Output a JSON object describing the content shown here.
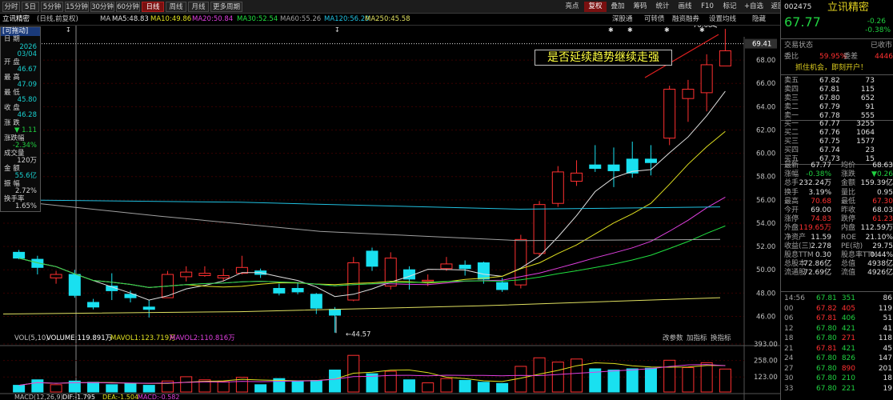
{
  "toolbar": {
    "left": [
      {
        "label": "分时",
        "active": false
      },
      {
        "label": "5日",
        "active": false
      },
      {
        "label": "5分钟",
        "active": false
      },
      {
        "label": "15分钟",
        "active": false
      },
      {
        "label": "30分钟",
        "active": false
      },
      {
        "label": "60分钟",
        "active": false
      },
      {
        "label": "日线",
        "active": true
      },
      {
        "label": "周线",
        "active": false
      },
      {
        "label": "月线",
        "active": false
      },
      {
        "label": "更多周期",
        "active": false
      }
    ],
    "right": [
      {
        "label": "亮点",
        "red": false
      },
      {
        "label": "复权",
        "red": true
      },
      {
        "label": "叠加",
        "red": false
      },
      {
        "label": "筹码",
        "red": false
      },
      {
        "label": "统计",
        "red": false
      },
      {
        "label": "画线",
        "red": false
      },
      {
        "label": "F10",
        "red": false
      },
      {
        "label": "标记",
        "red": false
      },
      {
        "label": "+自选",
        "red": false
      },
      {
        "label": "返回",
        "red": false
      }
    ]
  },
  "subbar": {
    "name": "立讯精密",
    "mode": "(日线,前复权)",
    "ma_label": "MA",
    "ma": [
      {
        "t": "MA5:48.83",
        "c": "#e0e0e0"
      },
      {
        "t": "MA10:49.86",
        "c": "#e0e020"
      },
      {
        "t": "MA20:50.84",
        "c": "#e040e0"
      },
      {
        "t": "MA30:52.54",
        "c": "#20e040"
      },
      {
        "t": "MA60:55.26",
        "c": "#a0a0a0"
      },
      {
        "t": "MA120:56.20",
        "c": "#20c0e0"
      },
      {
        "t": "MA250:45.58",
        "c": "#e0e060"
      }
    ],
    "links": [
      "深股通",
      "可转债",
      "融资融券",
      "设置均线"
    ],
    "close_label": "隐藏"
  },
  "panel": {
    "tag": "[可拖动]",
    "rows": [
      {
        "l": "日  期",
        "v": ""
      },
      {
        "l": "",
        "v": "2026"
      },
      {
        "l": "",
        "v": "03/04"
      },
      {
        "l": "开  盘",
        "v": ""
      },
      {
        "l": "",
        "v": "46.67",
        "c": "cyan"
      },
      {
        "l": "最  高",
        "v": ""
      },
      {
        "l": "",
        "v": "47.09",
        "c": "cyan"
      },
      {
        "l": "最  低",
        "v": ""
      },
      {
        "l": "",
        "v": "45.80",
        "c": "cyan"
      },
      {
        "l": "收  盘",
        "v": ""
      },
      {
        "l": "",
        "v": "46.28",
        "c": "cyan"
      },
      {
        "l": "涨  跌",
        "v": ""
      },
      {
        "l": "",
        "v": "▼ 1.11",
        "c": "green"
      },
      {
        "l": "涨跌幅",
        "v": ""
      },
      {
        "l": "",
        "v": "-2.34%",
        "c": "green"
      },
      {
        "l": "成交量",
        "v": ""
      },
      {
        "l": "",
        "v": "120万",
        "c": "white"
      },
      {
        "l": "金  额",
        "v": ""
      },
      {
        "l": "",
        "v": "55.6亿",
        "c": "cyan"
      },
      {
        "l": "振  幅",
        "v": ""
      },
      {
        "l": "",
        "v": "2.72%",
        "c": "white"
      },
      {
        "l": "换手率",
        "v": ""
      },
      {
        "l": "",
        "v": "1.65%",
        "c": "white"
      }
    ]
  },
  "annotation": "是否延续趋势继续走强",
  "chart_data": {
    "type": "candlestick",
    "price_axis": {
      "min": 45,
      "max": 70,
      "ticks": [
        46,
        48,
        50,
        52,
        54,
        56,
        58,
        60,
        62,
        64,
        66,
        68
      ],
      "current_label": "69.41"
    },
    "high_label": "70.68",
    "low_label": "44.57",
    "candles": [
      [
        51.5,
        51.0,
        51.7,
        50.9
      ],
      [
        50.9,
        50.2,
        51.2,
        49.6
      ],
      [
        49.3,
        49.6,
        49.9,
        48.8
      ],
      [
        49.6,
        47.8,
        50.0,
        47.6
      ],
      [
        47.2,
        46.8,
        47.5,
        46.6
      ],
      [
        48.6,
        48.2,
        49.7,
        47.4
      ],
      [
        47.9,
        47.6,
        48.2,
        47.2
      ],
      [
        46.8,
        46.6,
        47.4,
        45.9
      ],
      [
        47.6,
        49.6,
        49.9,
        47.6
      ],
      [
        49.4,
        49.8,
        50.3,
        49.0
      ],
      [
        49.5,
        49.7,
        50.3,
        49.4
      ],
      [
        49.3,
        49.5,
        50.1,
        49.0
      ],
      [
        49.7,
        50.2,
        51.2,
        49.6
      ],
      [
        49.9,
        49.6,
        50.1,
        49.3
      ],
      [
        48.4,
        48.0,
        48.8,
        47.8
      ],
      [
        48.4,
        48.1,
        48.9,
        47.9
      ],
      [
        47.9,
        46.7,
        48.0,
        46.2
      ],
      [
        46.6,
        46.1,
        46.8,
        44.6
      ],
      [
        47.4,
        50.6,
        51.1,
        47.3
      ],
      [
        51.6,
        50.3,
        51.9,
        49.9
      ],
      [
        48.6,
        51.0,
        51.5,
        48.3
      ],
      [
        50.0,
        49.2,
        50.3,
        48.3
      ],
      [
        49.0,
        49.1,
        49.6,
        48.6
      ],
      [
        50.1,
        50.5,
        51.1,
        49.9
      ],
      [
        50.4,
        50.1,
        50.8,
        49.5
      ],
      [
        50.6,
        49.2,
        50.7,
        48.8
      ],
      [
        48.9,
        48.3,
        49.3,
        48.1
      ],
      [
        48.7,
        52.6,
        53.0,
        48.4
      ],
      [
        51.4,
        55.6,
        55.9,
        51.2
      ],
      [
        55.7,
        58.4,
        58.9,
        55.4
      ],
      [
        57.6,
        58.3,
        59.4,
        57.2
      ],
      [
        59.0,
        58.7,
        60.7,
        58.4
      ],
      [
        59.0,
        58.5,
        60.5,
        57.1
      ],
      [
        59.5,
        58.3,
        61.0,
        57.9
      ],
      [
        59.5,
        59.2,
        60.7,
        58.1
      ],
      [
        61.3,
        65.5,
        65.8,
        60.7
      ],
      [
        64.7,
        65.5,
        66.3,
        62.7
      ],
      [
        65.2,
        67.6,
        68.5,
        63.6
      ],
      [
        67.5,
        68.8,
        70.68,
        68.4
      ]
    ],
    "indicators": {
      "vol": "VOL(5,10)",
      "volume": "VOLUME:119.891万",
      "mavol1": "MAVOL1:123.719万",
      "mavol2": "MAVOL2:110.816万",
      "volume_color": "#ffffff",
      "mavol1_color": "#e0e020",
      "mavol2_color": "#e040e0"
    },
    "volume_axis": {
      "ticks": [
        "393.00",
        "258.00",
        "123.00"
      ]
    },
    "volume_values": [
      55,
      100,
      60,
      90,
      80,
      60,
      70,
      55,
      90,
      125,
      100,
      85,
      120,
      60,
      110,
      85,
      95,
      180,
      300,
      150,
      170,
      100,
      75,
      110,
      95,
      80,
      70,
      210,
      280,
      245,
      270,
      190,
      180,
      190,
      195,
      260,
      200,
      240,
      188
    ],
    "macd": "MACD(12,26,9)",
    "dif": "DIF:-1.795",
    "dea": "DEA:-1.504",
    "macd_v": "MACD:-0.582",
    "indicator_buttons": [
      "改参数",
      "加指标",
      "换指标"
    ]
  },
  "right_panel": {
    "code": "002475",
    "name": "立讯精密",
    "price": "67.77",
    "change": "-0.26",
    "change_pct": "-0.38%",
    "trade_status_label": "交易状态",
    "trade_status_value": "已收市",
    "wb_label": "委比",
    "wb_value": "59.95%",
    "wc_label": "委差",
    "wc_value": "4446",
    "promo": "抓住机会，即刻开户！",
    "asks": [
      [
        "卖五",
        "67.82",
        "73"
      ],
      [
        "卖四",
        "67.81",
        "115"
      ],
      [
        "卖三",
        "67.80",
        "652"
      ],
      [
        "卖二",
        "67.79",
        "91"
      ],
      [
        "卖一",
        "67.78",
        "555"
      ]
    ],
    "bids": [
      [
        "买一",
        "67.77",
        "3255"
      ],
      [
        "买二",
        "67.76",
        "1064"
      ],
      [
        "买三",
        "67.75",
        "1577"
      ],
      [
        "买四",
        "67.74",
        "23"
      ],
      [
        "买五",
        "67.73",
        "15"
      ]
    ],
    "stats": [
      [
        "最新",
        "67.77",
        "均价",
        "68.63"
      ],
      [
        "涨幅",
        "-0.38%",
        "涨跌",
        "▼0.26"
      ],
      [
        "总手",
        "232.24万",
        "金额",
        "159.39亿"
      ],
      [
        "换手",
        "3.19%",
        "量比",
        "0.95"
      ],
      [
        "最高",
        "70.68",
        "最低",
        "67.30"
      ],
      [
        "今开",
        "69.00",
        "昨收",
        "68.03"
      ],
      [
        "涨停",
        "74.83",
        "跌停",
        "61.23"
      ],
      [
        "外盘",
        "119.65万",
        "内盘",
        "112.59万"
      ],
      [
        "净资产",
        "11.59",
        "ROE",
        "21.10%"
      ],
      [
        "收益(三)",
        "2.278",
        "PE(动)",
        "29.75"
      ],
      [
        "股息TTM",
        "0.30",
        "股息率TTM",
        "0.44%"
      ],
      [
        "总股本",
        "72.86亿",
        "总值",
        "4938亿"
      ],
      [
        "流通股",
        "72.69亿",
        "流值",
        "4926亿"
      ]
    ],
    "ticks": [
      [
        "14:56",
        "67.81",
        "351",
        "86"
      ],
      [
        "00",
        "67.82",
        "405",
        "119"
      ],
      [
        "06",
        "67.81",
        "406",
        "51"
      ],
      [
        "12",
        "67.80",
        "421",
        "41"
      ],
      [
        "18",
        "67.80",
        "271",
        "118"
      ],
      [
        "21",
        "67.81",
        "421",
        "45"
      ],
      [
        "24",
        "67.80",
        "826",
        "147"
      ],
      [
        "27",
        "67.80",
        "890",
        "201"
      ],
      [
        "30",
        "67.80",
        "210",
        "18"
      ],
      [
        "33",
        "67.80",
        "221",
        "19"
      ]
    ]
  }
}
